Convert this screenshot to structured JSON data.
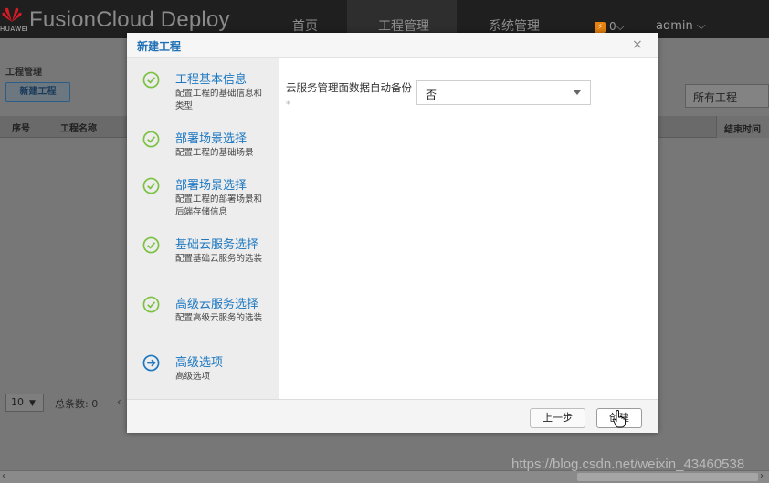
{
  "topbar": {
    "logo_sub": "HUAWEI",
    "brand": "FusionCloud Deploy",
    "nav": [
      "首页",
      "工程管理",
      "系统管理"
    ],
    "active_nav": 1,
    "alert_count": "0",
    "user": "admin"
  },
  "background_page": {
    "title": "工程管理",
    "new_button": "新建工程",
    "filter_value": "所有工程",
    "columns": [
      "序号",
      "工程名称",
      "结束时间"
    ],
    "page_size": "10",
    "total_label": "总条数: 0"
  },
  "modal": {
    "title": "新建工程",
    "steps": [
      {
        "title": "工程基本信息",
        "desc": "配置工程的基础信息和类型",
        "status": "done"
      },
      {
        "title": "部署场景选择",
        "desc": "配置工程的基础场景",
        "status": "done"
      },
      {
        "title": "部署场景选择",
        "desc": "配置工程的部署场景和后端存储信息",
        "status": "done"
      },
      {
        "title": "基础云服务选择",
        "desc": "配置基础云服务的选装",
        "status": "done"
      },
      {
        "title": "高级云服务选择",
        "desc": "配置高级云服务的选装",
        "status": "done"
      },
      {
        "title": "高级选项",
        "desc": "高级选项",
        "status": "current"
      }
    ],
    "field": {
      "label": "云服务管理面数据自动备份",
      "required_mark": "*",
      "value": "否"
    },
    "buttons": {
      "prev": "上一步",
      "create": "创建"
    }
  },
  "watermark": "https://blog.csdn.net/weixin_43460538",
  "colors": {
    "accent": "#1d78c1",
    "done": "#7cc242",
    "current": "#1d78c1"
  }
}
